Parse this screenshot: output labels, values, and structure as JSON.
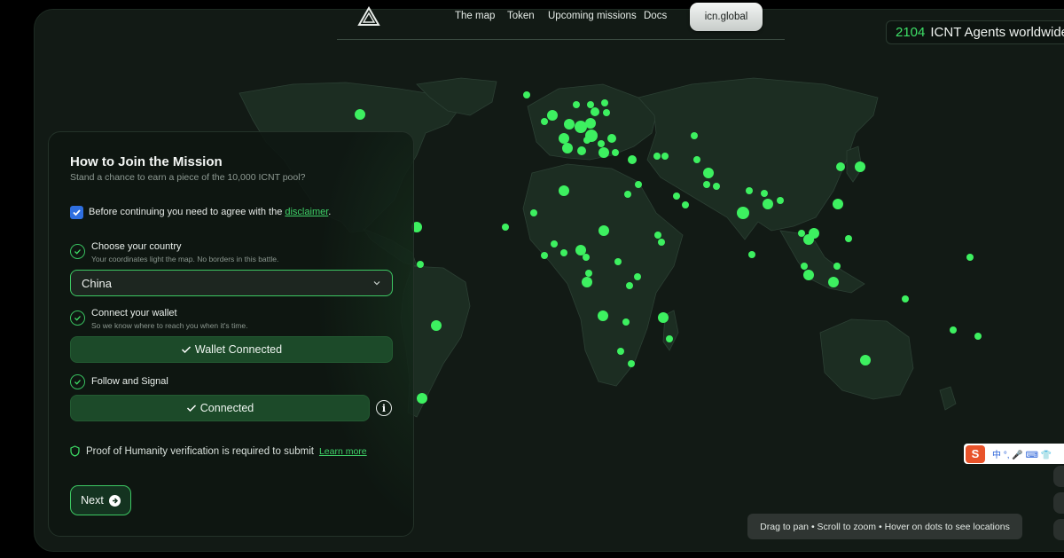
{
  "nav": {
    "links": [
      "The map",
      "Token",
      "Upcoming missions",
      "Docs"
    ],
    "cta": "icn.global"
  },
  "counter": {
    "value": "2104",
    "label": "ICNT Agents worldwide"
  },
  "panel": {
    "title": "How to Join the Mission",
    "subtitle": "Stand a chance to earn a piece of the 10,000 ICNT pool?",
    "disclaimer_text": "Before continuing you need to agree with the ",
    "disclaimer_link": "disclaimer",
    "disclaimer_end": ".",
    "disclaimer_checked": true,
    "steps": [
      {
        "title": "Choose your country",
        "subtitle": "Your coordinates light the map. No borders in this battle."
      },
      {
        "title": "Connect your wallet",
        "subtitle": "So we know where to reach you when it's time."
      },
      {
        "title": "Follow and Signal",
        "subtitle": ""
      }
    ],
    "country_value": "China",
    "wallet_button": "Wallet Connected",
    "follow_button": "Connected",
    "proof_text": "Proof of Humanity verification is required to submit",
    "proof_link": "Learn more",
    "next_label": "Next"
  },
  "hint": "Drag to pan • Scroll to zoom • Hover on dots to see locations",
  "ime": {
    "logo": "S",
    "text": "中 °, 🎤 ⌨ 👕"
  },
  "colors": {
    "accent": "#3ee067",
    "dot": "#3df060",
    "land": "#1c2d22",
    "background": "#121a15"
  }
}
